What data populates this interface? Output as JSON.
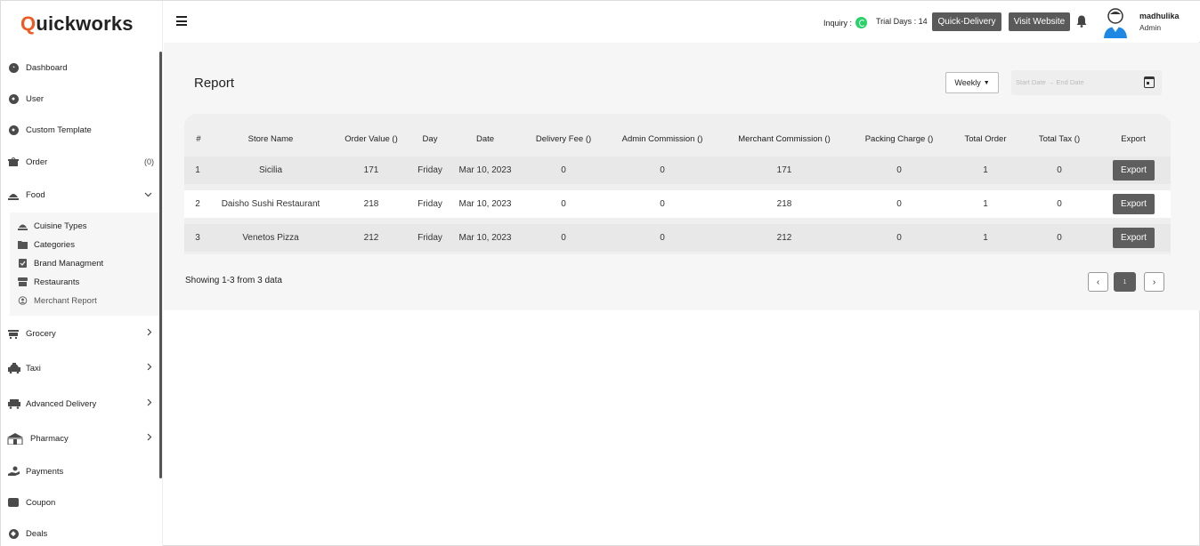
{
  "brand": {
    "logo_q": "Q",
    "logo_rest": "uickworks"
  },
  "sidebar": {
    "items": [
      {
        "label": "Dashboard",
        "icon": "dashboard-icon"
      },
      {
        "label": "User",
        "icon": "user-icon"
      },
      {
        "label": "Custom Template",
        "icon": "template-icon"
      },
      {
        "label": "Order",
        "icon": "order-icon",
        "badge": "(0)"
      },
      {
        "label": "Food",
        "icon": "food-icon",
        "expanded": true
      },
      {
        "label": "Grocery",
        "icon": "grocery-icon"
      },
      {
        "label": "Taxi",
        "icon": "taxi-icon"
      },
      {
        "label": "Advanced Delivery",
        "icon": "delivery-truck-icon"
      },
      {
        "label": "Pharmacy",
        "icon": "pharmacy-icon"
      },
      {
        "label": "Payments",
        "icon": "payments-icon"
      },
      {
        "label": "Coupon",
        "icon": "coupon-icon"
      },
      {
        "label": "Deals",
        "icon": "deals-icon"
      }
    ],
    "food_submenu": [
      {
        "label": "Cuisine Types",
        "icon": "cuisine-icon"
      },
      {
        "label": "Categories",
        "icon": "categories-icon"
      },
      {
        "label": "Brand Managment",
        "icon": "brand-icon"
      },
      {
        "label": "Restaurants",
        "icon": "restaurant-icon"
      },
      {
        "label": "Merchant Report",
        "icon": "report-icon",
        "active": true
      }
    ]
  },
  "header": {
    "inquiry_label": "Inquiry :",
    "trial_days": "Trial Days : 14",
    "quick_delivery": "Quick-Delivery",
    "visit_website": "Visit Website",
    "user_name": "madhulika",
    "user_role": "Admin"
  },
  "report": {
    "title": "Report",
    "period": "Weekly",
    "date_placeholder": "Start Date → End Date",
    "columns": [
      "#",
      "Store Name",
      "Order Value ()",
      "Day",
      "Date",
      "Delivery Fee ()",
      "Admin Commission ()",
      "Merchant Commission ()",
      "Packing Charge ()",
      "Total Order",
      "Total Tax ()",
      "Export"
    ],
    "rows": [
      {
        "num": "1",
        "store": "Sicilia",
        "order_value": "171",
        "day": "Friday",
        "date": "Mar 10, 2023",
        "delivery_fee": "0",
        "admin_commission": "0",
        "merchant_commission": "171",
        "packing_charge": "0",
        "total_order": "1",
        "total_tax": "0",
        "export": "Export"
      },
      {
        "num": "2",
        "store": "Daisho Sushi Restaurant",
        "order_value": "218",
        "day": "Friday",
        "date": "Mar 10, 2023",
        "delivery_fee": "0",
        "admin_commission": "0",
        "merchant_commission": "218",
        "packing_charge": "0",
        "total_order": "1",
        "total_tax": "0",
        "export": "Export"
      },
      {
        "num": "3",
        "store": "Venetos Pizza",
        "order_value": "212",
        "day": "Friday",
        "date": "Mar 10, 2023",
        "delivery_fee": "0",
        "admin_commission": "0",
        "merchant_commission": "212",
        "packing_charge": "0",
        "total_order": "1",
        "total_tax": "0",
        "export": "Export"
      }
    ],
    "showing": "Showing 1-3 from 3 data",
    "pagination": {
      "prev": "‹",
      "current": "1",
      "next": "›"
    }
  },
  "colors": {
    "brand_accent": "#f05a22",
    "button_dark": "#5a5a5a",
    "whatsapp": "#25d366"
  }
}
